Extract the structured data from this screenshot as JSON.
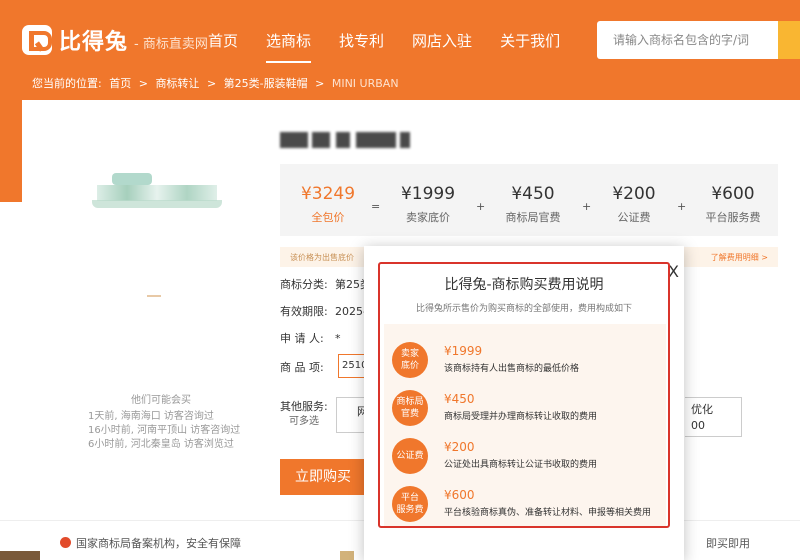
{
  "header": {
    "brand": "比得兔",
    "slogan": "- 商标直卖网",
    "nav": [
      "首页",
      "选商标",
      "找专利",
      "网店入驻",
      "关于我们"
    ],
    "active_nav": "选商标",
    "search_placeholder": "请输入商标名包含的字/词"
  },
  "breadcrumb": {
    "prefix": "您当前的位置:",
    "items": [
      "首页",
      "商标转让",
      "第25类-服装鞋帽"
    ],
    "current": "MINI URBAN",
    "sep": ">"
  },
  "left": {
    "maybe_like": "他们可能会买",
    "visits": [
      "1天前, 海南海口 访客咨询过",
      "16小时前, 河南平顶山 访客咨询过",
      "6小时前, 河北秦皇岛 访客浏览过"
    ]
  },
  "price": {
    "total": {
      "value": "¥3249",
      "label": "全包价"
    },
    "eq": "=",
    "plus": "+",
    "parts": [
      {
        "value": "¥1999",
        "label": "卖家底价"
      },
      {
        "value": "¥450",
        "label": "商标局官费"
      },
      {
        "value": "¥200",
        "label": "公证费"
      },
      {
        "value": "¥600",
        "label": "平台服务费"
      }
    ],
    "notice": "该价格为出售底价",
    "notice_link": "了解费用明细 >"
  },
  "fields": {
    "category_label": "商标分类:",
    "category_value": "第25类",
    "validity_label": "有效期限:",
    "validity_value": "2025-",
    "applicant_label": "申 请 人:",
    "applicant_value": "*",
    "goods_label": "商 品 项:",
    "goods_value": "2510"
  },
  "services": {
    "label": "其他服务:",
    "sub": "可多选",
    "box1": "网",
    "box2_line1": "优化",
    "box2_line2": "00"
  },
  "buy_label": "立即购买",
  "footer": {
    "item1": "国家商标局备案机构，安全有保障",
    "item2": "即买即用"
  },
  "modal": {
    "title": "比得兔-商标购买费用说明",
    "subtitle": "比得兔所示售价为购买商标的全部使用，费用构成如下",
    "close": "X",
    "fees": [
      {
        "badge": [
          "卖家",
          "底价"
        ],
        "amount": "¥1999",
        "desc": "该商标持有人出售商标的最低价格"
      },
      {
        "badge": [
          "商标局",
          "官费"
        ],
        "amount": "¥450",
        "desc": "商标局受理并办理商标转让收取的费用"
      },
      {
        "badge": [
          "公证费"
        ],
        "amount": "¥200",
        "desc": "公证处出具商标转让公证书收取的费用"
      },
      {
        "badge": [
          "平台",
          "服务费"
        ],
        "amount": "¥600",
        "desc": "平台核验商标真伪、准备转让材料、申报等相关费用"
      }
    ]
  },
  "colors": {
    "brand": "#f0772c",
    "accent_search": "#f9b632",
    "modal_border": "#d9342b"
  }
}
